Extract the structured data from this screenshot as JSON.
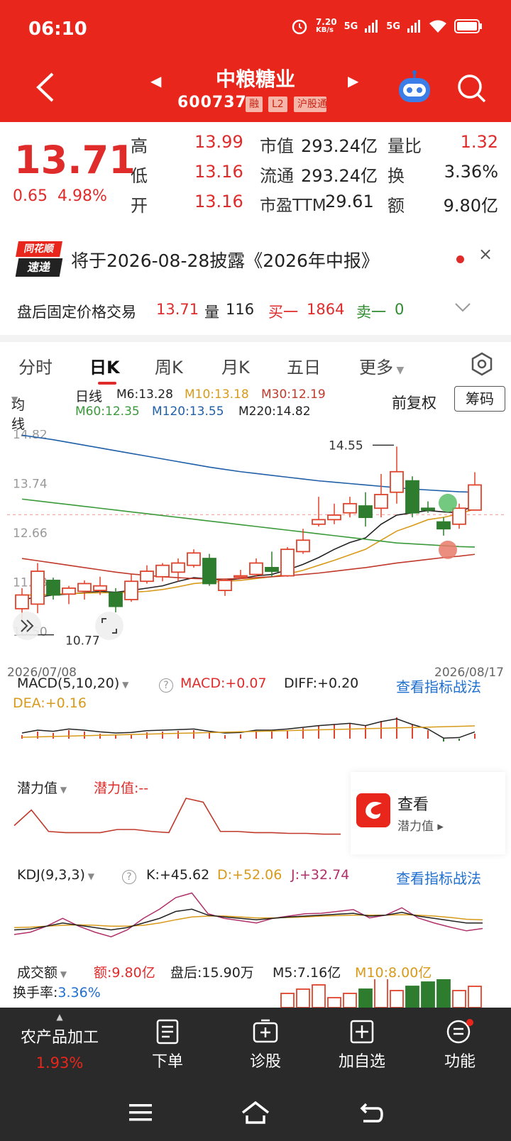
{
  "status": {
    "time": "06:10",
    "speed": "7.20",
    "speed_unit": "KB/s",
    "net1": "5G",
    "net2": "5G"
  },
  "header": {
    "name": "中粮糖业",
    "code": "600737",
    "tags": [
      "融",
      "L2",
      "沪股通"
    ]
  },
  "quote": {
    "price": "13.71",
    "change": "0.65",
    "change_pct": "4.98%",
    "rows": [
      {
        "l1": "高",
        "v1": "13.99",
        "l2": "市值",
        "v2": "293.24亿",
        "l3": "量比",
        "v3": "1.32"
      },
      {
        "l1": "低",
        "v1": "13.16",
        "l2": "流通",
        "v2": "293.24亿",
        "l3": "换",
        "v3": "3.36%"
      },
      {
        "l1": "开",
        "v1": "13.16",
        "l2": "市盈TTM",
        "v2": "29.61",
        "l3": "额",
        "v3": "9.80亿"
      }
    ]
  },
  "notice": {
    "logo_top": "同花顺",
    "logo_bottom": "速递",
    "text": "将于2026-08-28披露《2026年中报》",
    "close": "×"
  },
  "after_hours": {
    "label": "盘后固定价格交易",
    "price": "13.71",
    "vol_label": "量",
    "vol": "116",
    "bid_label": "买一",
    "bid": "1864",
    "ask_label": "卖一",
    "ask": "0"
  },
  "tabs": [
    "分时",
    "日K",
    "周K",
    "月K",
    "五日",
    "更多"
  ],
  "ma": {
    "toggle": "均线",
    "period": "日线",
    "items": [
      {
        "label": "M6:13.28",
        "color": "#222222"
      },
      {
        "label": "M10:13.18",
        "color": "#d89a1a"
      },
      {
        "label": "M30:12.19",
        "color": "#c0392b"
      },
      {
        "label": "M60:12.35",
        "color": "#3a9a3a"
      },
      {
        "label": "M120:13.55",
        "color": "#1f5fa8"
      },
      {
        "label": "M220:14.82",
        "color": "#222222"
      }
    ],
    "adjust": "前复权",
    "chip": "筹码"
  },
  "chart_data": {
    "type": "candlestick",
    "y_ticks": [
      "14.82",
      "13.74",
      "12.66",
      "11.58",
      "10.50"
    ],
    "ylim": [
      10.5,
      14.82
    ],
    "x_start": "2026/07/08",
    "x_end": "2026/08/17",
    "high_annotation": "14.55",
    "low_annotation": "10.77",
    "candles": [
      {
        "o": 11.0,
        "h": 11.45,
        "l": 10.77,
        "c": 11.3
      },
      {
        "o": 11.1,
        "h": 12.0,
        "l": 10.9,
        "c": 11.82
      },
      {
        "o": 11.62,
        "h": 11.68,
        "l": 11.2,
        "c": 11.3
      },
      {
        "o": 11.32,
        "h": 11.5,
        "l": 11.1,
        "c": 11.45
      },
      {
        "o": 11.38,
        "h": 11.62,
        "l": 11.2,
        "c": 11.55
      },
      {
        "o": 11.4,
        "h": 11.7,
        "l": 11.3,
        "c": 11.5
      },
      {
        "o": 11.35,
        "h": 11.45,
        "l": 10.92,
        "c": 11.05
      },
      {
        "o": 11.2,
        "h": 11.75,
        "l": 11.15,
        "c": 11.6
      },
      {
        "o": 11.6,
        "h": 11.95,
        "l": 11.55,
        "c": 11.82
      },
      {
        "o": 11.7,
        "h": 12.0,
        "l": 11.6,
        "c": 11.95
      },
      {
        "o": 11.8,
        "h": 12.1,
        "l": 11.6,
        "c": 12.0
      },
      {
        "o": 11.95,
        "h": 12.3,
        "l": 11.9,
        "c": 12.22
      },
      {
        "o": 12.1,
        "h": 12.2,
        "l": 11.5,
        "c": 11.55
      },
      {
        "o": 11.4,
        "h": 11.65,
        "l": 11.28,
        "c": 11.62
      },
      {
        "o": 11.7,
        "h": 11.85,
        "l": 11.65,
        "c": 11.72
      },
      {
        "o": 11.75,
        "h": 12.1,
        "l": 11.7,
        "c": 12.0
      },
      {
        "o": 11.9,
        "h": 12.25,
        "l": 11.7,
        "c": 11.82
      },
      {
        "o": 11.72,
        "h": 12.35,
        "l": 11.7,
        "c": 12.3
      },
      {
        "o": 12.25,
        "h": 12.75,
        "l": 12.2,
        "c": 12.5
      },
      {
        "o": 12.85,
        "h": 13.45,
        "l": 12.8,
        "c": 12.95
      },
      {
        "o": 12.95,
        "h": 13.3,
        "l": 12.85,
        "c": 13.05
      },
      {
        "o": 13.1,
        "h": 13.45,
        "l": 13.0,
        "c": 13.3
      },
      {
        "o": 13.25,
        "h": 13.55,
        "l": 12.8,
        "c": 13.0
      },
      {
        "o": 13.2,
        "h": 13.95,
        "l": 13.0,
        "c": 13.5
      },
      {
        "o": 13.55,
        "h": 14.55,
        "l": 13.3,
        "c": 14.0
      },
      {
        "o": 13.8,
        "h": 13.9,
        "l": 13.0,
        "c": 13.1
      },
      {
        "o": 13.2,
        "h": 13.35,
        "l": 13.1,
        "c": 13.16
      },
      {
        "o": 12.9,
        "h": 13.0,
        "l": 12.6,
        "c": 12.75
      },
      {
        "o": 12.85,
        "h": 13.3,
        "l": 12.75,
        "c": 13.2
      },
      {
        "o": 13.16,
        "h": 13.99,
        "l": 13.16,
        "c": 13.71
      }
    ],
    "ma_lines": [
      {
        "name": "M6",
        "color": "#222222",
        "values": [
          11.2,
          11.25,
          11.3,
          11.32,
          11.35,
          11.38,
          11.36,
          11.4,
          11.45,
          11.5,
          11.6,
          11.68,
          11.65,
          11.62,
          11.66,
          11.72,
          11.75,
          11.85,
          11.97,
          12.12,
          12.3,
          12.45,
          12.55,
          12.85,
          13.05,
          13.1,
          13.15,
          13.12,
          13.1,
          13.28
        ]
      },
      {
        "name": "M10",
        "color": "#d89a1a",
        "values": [
          11.3,
          11.3,
          11.32,
          11.33,
          11.34,
          11.35,
          11.35,
          11.36,
          11.38,
          11.42,
          11.48,
          11.55,
          11.58,
          11.6,
          11.62,
          11.66,
          11.7,
          11.76,
          11.84,
          11.95,
          12.06,
          12.18,
          12.3,
          12.5,
          12.7,
          12.82,
          12.95,
          13.0,
          13.08,
          13.18
        ]
      },
      {
        "name": "M30",
        "color": "#c0392b",
        "values": [
          12.1,
          12.05,
          12.0,
          11.95,
          11.9,
          11.85,
          11.8,
          11.76,
          11.73,
          11.7,
          11.68,
          11.66,
          11.65,
          11.65,
          11.66,
          11.68,
          11.7,
          11.72,
          11.75,
          11.78,
          11.82,
          11.86,
          11.9,
          11.95,
          12.0,
          12.04,
          12.08,
          12.12,
          12.15,
          12.19
        ]
      },
      {
        "name": "M60",
        "color": "#3a9a3a",
        "values": [
          13.4,
          13.36,
          13.32,
          13.28,
          13.24,
          13.2,
          13.16,
          13.12,
          13.08,
          13.04,
          13.0,
          12.96,
          12.92,
          12.88,
          12.84,
          12.8,
          12.76,
          12.72,
          12.68,
          12.64,
          12.6,
          12.56,
          12.52,
          12.48,
          12.44,
          12.42,
          12.4,
          12.38,
          12.36,
          12.35
        ]
      },
      {
        "name": "M120",
        "color": "#1f5fa8",
        "values": [
          14.8,
          14.75,
          14.7,
          14.64,
          14.58,
          14.52,
          14.46,
          14.4,
          14.34,
          14.28,
          14.22,
          14.16,
          14.1,
          14.05,
          14.0,
          13.96,
          13.92,
          13.88,
          13.84,
          13.8,
          13.77,
          13.74,
          13.71,
          13.68,
          13.65,
          13.62,
          13.6,
          13.58,
          13.56,
          13.55
        ]
      }
    ]
  },
  "macd": {
    "title": "MACD(5,10,20)",
    "macd": "MACD:+0.07",
    "diff": "DIFF:+0.20",
    "dea": "DEA:+0.16",
    "link": "查看指标战法",
    "bars": [
      0.05,
      0.1,
      0.08,
      0.12,
      0.1,
      0.07,
      0.05,
      0.06,
      0.09,
      0.1,
      0.11,
      0.12,
      0.08,
      0.05,
      0.06,
      0.1,
      0.1,
      0.12,
      0.15,
      0.18,
      0.2,
      0.22,
      0.18,
      0.25,
      0.3,
      0.2,
      0.12,
      -0.04,
      -0.03,
      0.07
    ]
  },
  "potential": {
    "title": "潜力值",
    "value": "潜力值:--",
    "promo_title": "查看",
    "promo_sub": "潜力值 ▸",
    "values": [
      0.3,
      0.7,
      0.15,
      0.12,
      0.12,
      0.12,
      0.2,
      0.2,
      0.15,
      0.12,
      1.0,
      0.9,
      0.15,
      0.15,
      0.12,
      0.12,
      0.1,
      0.1,
      0.08,
      0.08
    ]
  },
  "kdj": {
    "title": "KDJ(9,3,3)",
    "k": "K:+45.62",
    "d": "D:+52.06",
    "j": "J:+32.74",
    "link": "查看指标战法",
    "k_vals": [
      30,
      32,
      38,
      45,
      40,
      35,
      30,
      35,
      45,
      55,
      70,
      75,
      62,
      58,
      55,
      52,
      55,
      58,
      60,
      62,
      64,
      66,
      60,
      62,
      68,
      60,
      55,
      50,
      45,
      45
    ],
    "d_vals": [
      35,
      36,
      38,
      40,
      41,
      40,
      38,
      38,
      40,
      45,
      52,
      58,
      60,
      60,
      58,
      56,
      56,
      57,
      58,
      60,
      61,
      62,
      62,
      62,
      63,
      62,
      60,
      57,
      53,
      52
    ],
    "j_vals": [
      20,
      25,
      38,
      55,
      38,
      25,
      15,
      30,
      55,
      75,
      100,
      110,
      65,
      55,
      50,
      45,
      55,
      60,
      65,
      66,
      70,
      74,
      56,
      62,
      78,
      56,
      45,
      36,
      28,
      33
    ]
  },
  "turnover": {
    "title": "成交额",
    "amount": "额:9.80亿",
    "after": "盘后:15.90万",
    "m5": "M5:7.16亿",
    "m10": "M10:8.00亿",
    "rate_label": "换手率:",
    "rate": "3.36%"
  },
  "bottom_bar": {
    "sector": "农产品加工",
    "sector_pct": "1.93%",
    "items": [
      "下单",
      "诊股",
      "加自选",
      "功能"
    ]
  }
}
